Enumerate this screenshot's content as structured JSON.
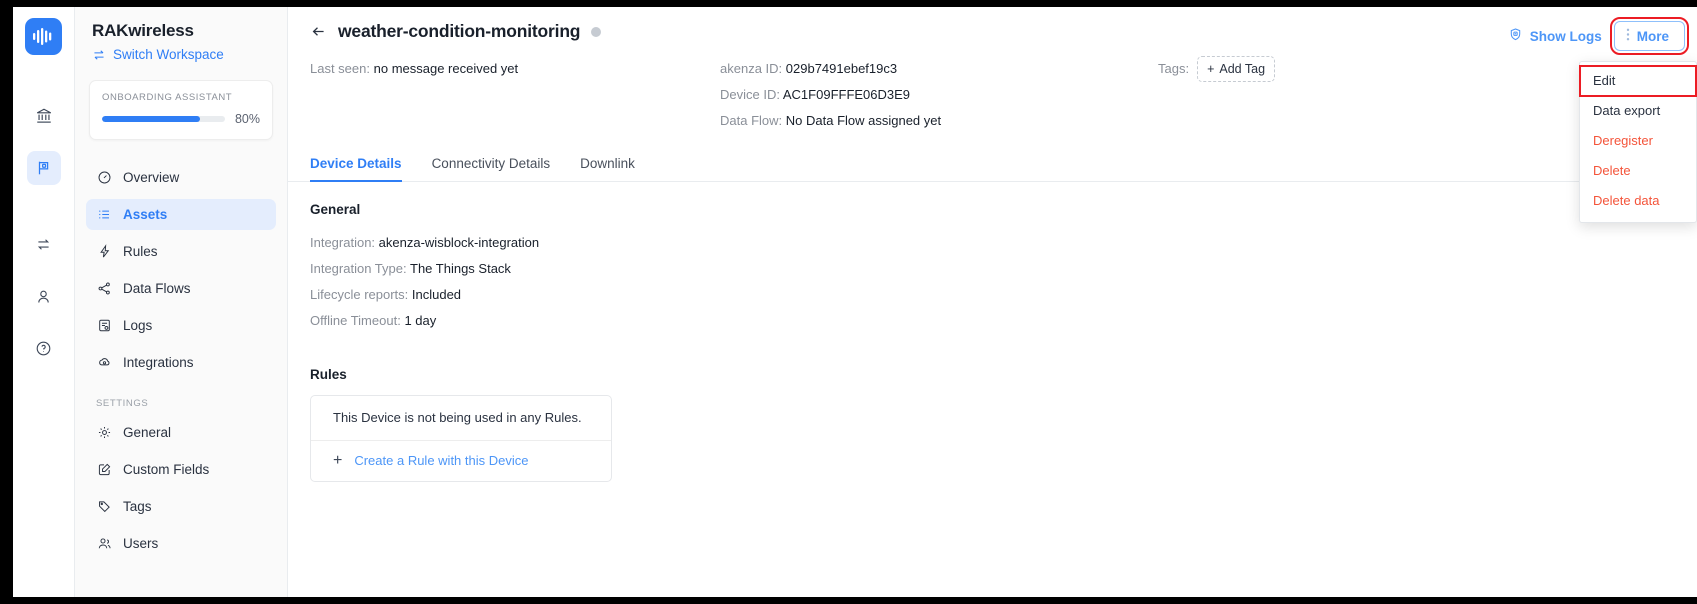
{
  "rail": {
    "logo_name": "akenza-logo",
    "items": [
      {
        "name": "organization",
        "icon": "bank-icon",
        "active": false
      },
      {
        "name": "workspaces",
        "icon": "flag-icon",
        "active": true
      },
      {
        "name": "transfer",
        "icon": "swap-icon",
        "active": false
      },
      {
        "name": "account",
        "icon": "user-icon",
        "active": false
      },
      {
        "name": "help",
        "icon": "question-circle-icon",
        "active": false
      }
    ]
  },
  "sidebar": {
    "workspace_name": "RAKwireless",
    "switch_workspace": "Switch Workspace",
    "onboarding": {
      "title": "ONBOARDING ASSISTANT",
      "percent_label": "80%",
      "percent_value": 80
    },
    "nav": [
      {
        "label": "Overview",
        "icon": "gauge-icon",
        "active": false
      },
      {
        "label": "Assets",
        "icon": "list-icon",
        "active": true
      },
      {
        "label": "Rules",
        "icon": "bolt-icon",
        "active": false
      },
      {
        "label": "Data Flows",
        "icon": "share-icon",
        "active": false
      },
      {
        "label": "Logs",
        "icon": "log-icon",
        "active": false
      },
      {
        "label": "Integrations",
        "icon": "cloud-icon",
        "active": false
      }
    ],
    "settings_label": "SETTINGS",
    "settings_nav": [
      {
        "label": "General",
        "icon": "gear-icon"
      },
      {
        "label": "Custom Fields",
        "icon": "edit-square-icon"
      },
      {
        "label": "Tags",
        "icon": "tag-icon"
      },
      {
        "label": "Users",
        "icon": "users-icon"
      }
    ]
  },
  "header": {
    "back_icon": "arrow-left-icon",
    "device_title": "weather-condition-monitoring",
    "status": "offline",
    "last_seen_key": "Last seen:",
    "last_seen_value": "no message received yet",
    "akenza_id_key": "akenza ID:",
    "akenza_id_value": "029b7491ebef19c3",
    "device_id_key": "Device ID:",
    "device_id_value": "AC1F09FFFE06D3E9",
    "data_flow_key": "Data Flow:",
    "data_flow_value": "No Data Flow assigned yet",
    "tags_label": "Tags:",
    "add_tag_label": "Add Tag",
    "show_logs_label": "Show Logs",
    "more_label": "More"
  },
  "more_menu": {
    "items": [
      {
        "label": "Edit",
        "danger": false,
        "highlighted": true
      },
      {
        "label": "Data export",
        "danger": false,
        "highlighted": false
      },
      {
        "label": "Deregister",
        "danger": true,
        "highlighted": false
      },
      {
        "label": "Delete",
        "danger": true,
        "highlighted": false
      },
      {
        "label": "Delete data",
        "danger": true,
        "highlighted": false
      }
    ]
  },
  "tabs": [
    {
      "label": "Device Details",
      "active": true
    },
    {
      "label": "Connectivity Details",
      "active": false
    },
    {
      "label": "Downlink",
      "active": false
    }
  ],
  "general": {
    "section_title": "General",
    "rows": [
      {
        "key": "Integration:",
        "value": "akenza-wisblock-integration"
      },
      {
        "key": "Integration Type:",
        "value": "The Things Stack"
      },
      {
        "key": "Lifecycle reports:",
        "value": "Included"
      },
      {
        "key": "Offline Timeout:",
        "value": "1 day"
      }
    ]
  },
  "rules": {
    "section_title": "Rules",
    "empty_text": "This Device is not being used in any Rules.",
    "create_link": "Create a Rule with this Device"
  },
  "colors": {
    "accent": "#2f7ef5",
    "link": "#4d96f7",
    "danger": "#f4543a",
    "highlight_box": "#ec1c24",
    "sidebar_bg": "#fafafa"
  }
}
